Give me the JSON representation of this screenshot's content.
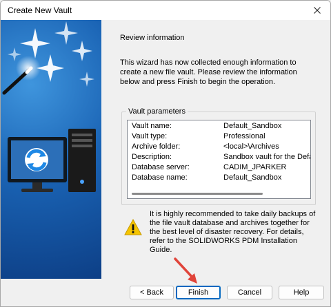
{
  "window": {
    "title": "Create New Vault"
  },
  "content": {
    "heading": "Review information",
    "intro": "This wizard has now collected enough information to create a new file vault. Please review the information below and press Finish to begin the operation."
  },
  "vault_parameters": {
    "group_label": "Vault parameters",
    "rows": [
      {
        "label": "Vault name:",
        "value": "Default_Sandbox"
      },
      {
        "label": "Vault type:",
        "value": "Professional"
      },
      {
        "label": "Archive folder:",
        "value": "<local>\\Archives"
      },
      {
        "label": "Description:",
        "value": "Sandbox vault for the Default P"
      },
      {
        "label": "Database server:",
        "value": "CADIM_JPARKER"
      },
      {
        "label": "Database name:",
        "value": "Default_Sandbox"
      }
    ]
  },
  "warning": {
    "icon": "warning-triangle-icon",
    "text": "It is highly recommended to take daily backups of the file vault database and archives together for the best level of disaster recovery. For details, refer to the SOLIDWORKS PDM Installation Guide."
  },
  "buttons": {
    "back": "< Back",
    "finish": "Finish",
    "cancel": "Cancel",
    "help": "Help"
  },
  "colors": {
    "accent": "#0067c0",
    "side_panel": "#1a63b4",
    "annotation_arrow": "#e0443a",
    "warning": "#f5c400"
  }
}
